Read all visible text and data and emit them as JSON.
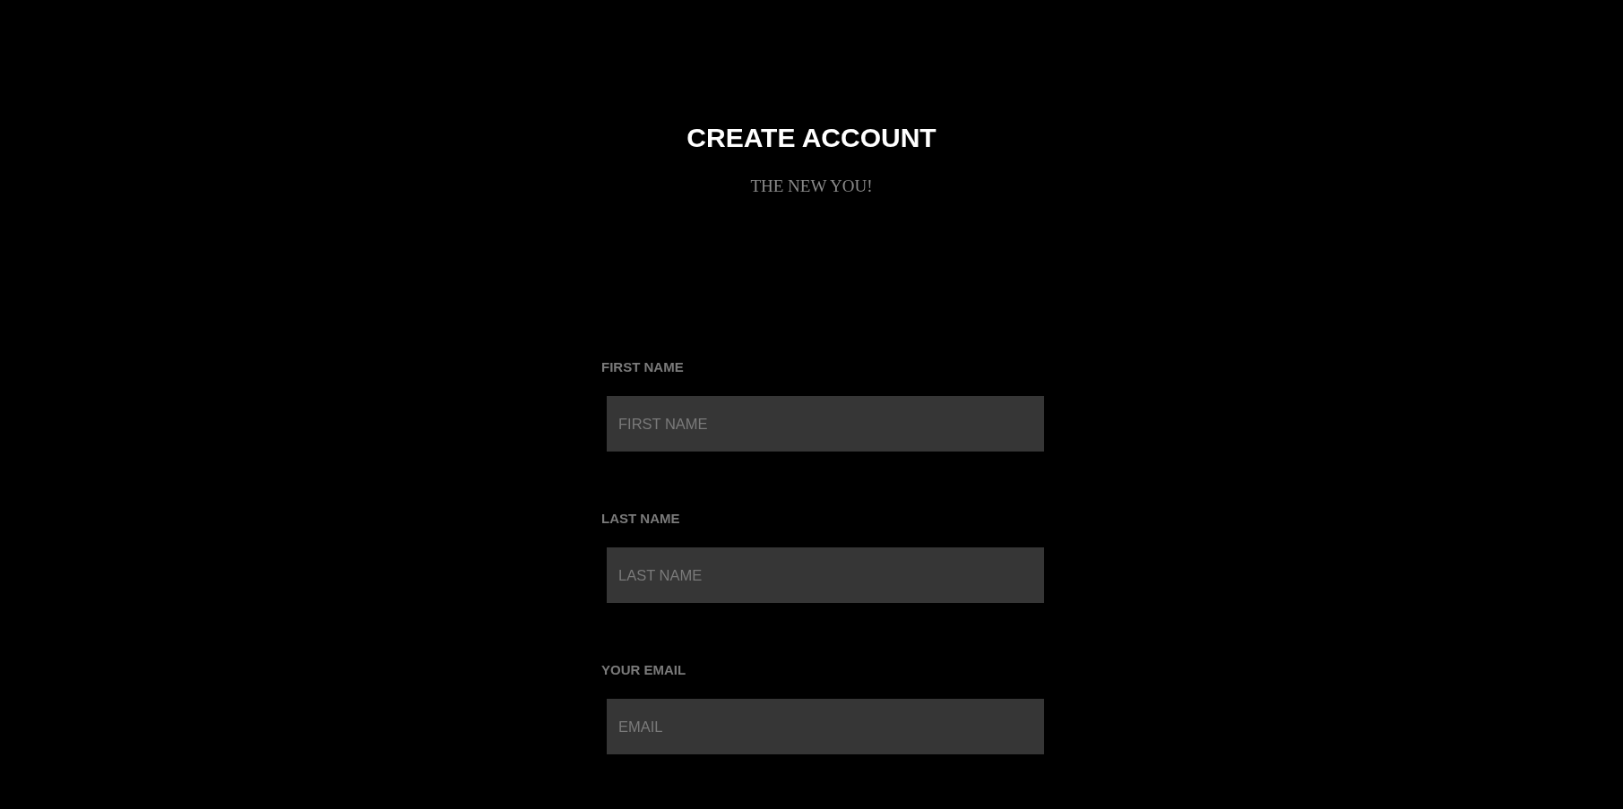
{
  "header": {
    "title": "CREATE ACCOUNT",
    "subtitle": "THE NEW YOU!"
  },
  "form": {
    "fields": [
      {
        "label": "FIRST NAME",
        "placeholder": "FIRST NAME"
      },
      {
        "label": "LAST NAME",
        "placeholder": "LAST NAME"
      },
      {
        "label": "YOUR EMAIL",
        "placeholder": "EMAIL"
      }
    ]
  }
}
